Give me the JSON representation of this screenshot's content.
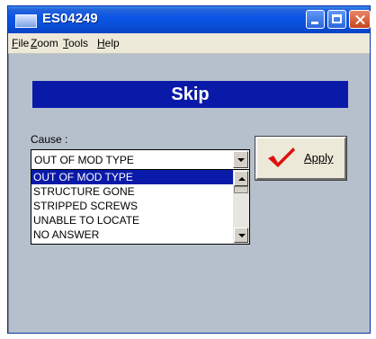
{
  "window": {
    "title": "ES04249"
  },
  "menu": {
    "file": {
      "mnemonic": "F",
      "rest": "ile"
    },
    "zoom": {
      "mnemonic": "Z",
      "rest": "oom"
    },
    "tools": {
      "mnemonic": "T",
      "rest": "ools"
    },
    "help": {
      "mnemonic": "H",
      "rest": "elp"
    }
  },
  "header": {
    "title": "Skip"
  },
  "cause": {
    "label": "Cause :",
    "selected_value": "OUT OF MOD TYPE",
    "options": [
      "OUT OF MOD TYPE",
      "STRUCTURE GONE",
      "STRIPPED SCREWS",
      "UNABLE TO LOCATE",
      "NO ANSWER"
    ]
  },
  "apply": {
    "label": "Apply",
    "icon": "red-checkmark-icon"
  },
  "colors": {
    "titlebar": "#0b55e6",
    "header_band": "#0a1aa8",
    "content_bg": "#b6c0cc",
    "check": "#e01010"
  }
}
